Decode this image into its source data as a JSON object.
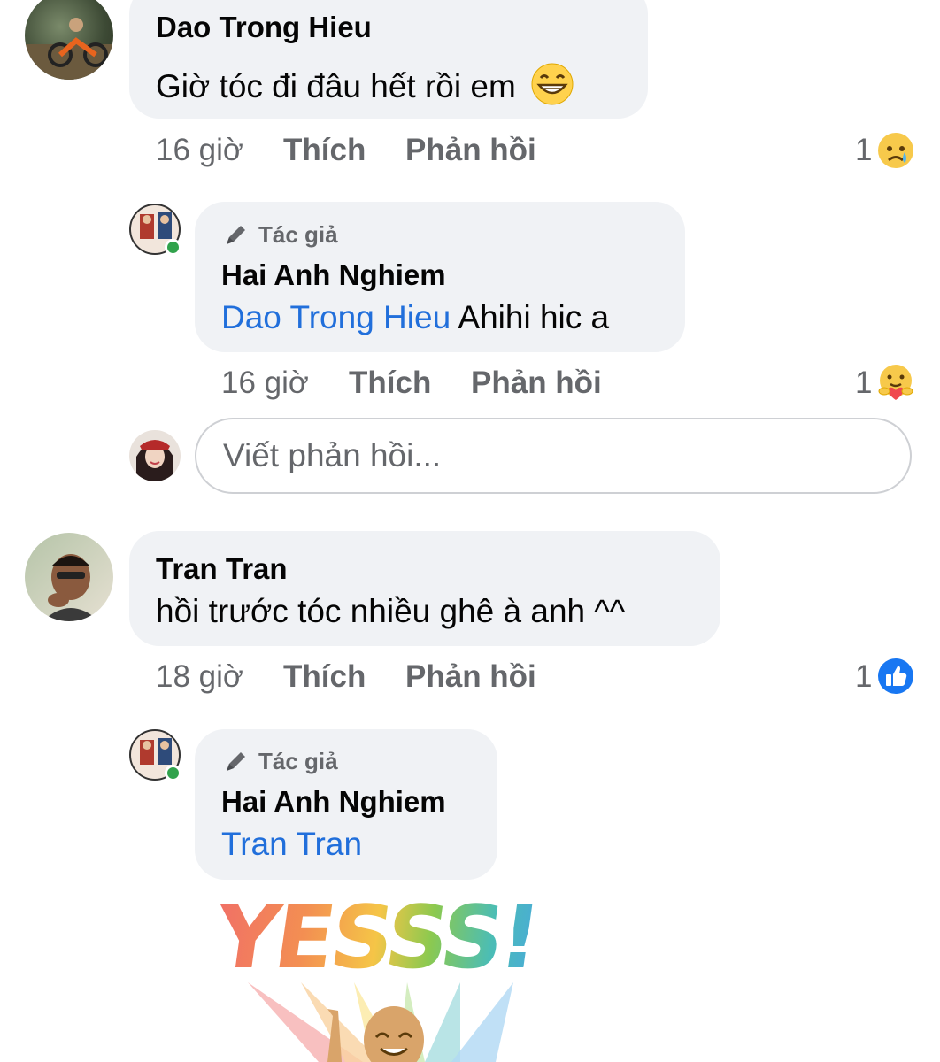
{
  "comments": [
    {
      "author": "Dao Trong Hieu",
      "text": "Giờ tóc đi đâu hết rồi em",
      "time": "16 giờ",
      "like_label": "Thích",
      "reply_label": "Phản hồi",
      "reaction_count": "1",
      "reaction_icon": "sad-reaction-icon",
      "reply": {
        "author_badge": "Tác giả",
        "author": "Hai Anh Nghiem",
        "mention": "Dao Trong Hieu",
        "text": "Ahihi hic a",
        "time": "16 giờ",
        "like_label": "Thích",
        "reply_label": "Phản hồi",
        "reaction_count": "1",
        "reaction_icon": "care-reaction-icon"
      }
    },
    {
      "author": "Tran Tran",
      "text": "hồi trước tóc nhiều ghê à anh ^^",
      "time": "18 giờ",
      "like_label": "Thích",
      "reply_label": "Phản hồi",
      "reaction_count": "1",
      "reaction_icon": "like-reaction-icon",
      "reply": {
        "author_badge": "Tác giả",
        "author": "Hai Anh Nghiem",
        "mention": "Tran Tran",
        "sticker_text": "YESSS!"
      }
    }
  ],
  "reply_box": {
    "placeholder": "Viết phản hồi..."
  },
  "colors": {
    "bubble": "#f0f2f5",
    "mention": "#216fdb",
    "meta": "#65676b",
    "like_blue": "#1877f2",
    "online": "#31a24c"
  }
}
